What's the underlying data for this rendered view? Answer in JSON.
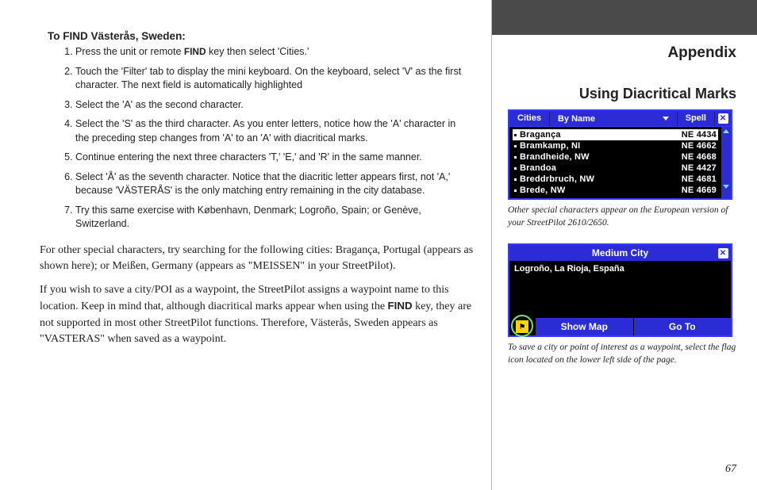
{
  "left": {
    "instr_title_prefix": "To FIND ",
    "instr_title_city": "Västerås, Sweden:",
    "steps": [
      "Press the unit or remote <b>FIND</b> key then select 'Cities.'",
      "Touch the 'Filter' tab to display the mini keyboard. On the keyboard, select 'V' as the first character. The next field is automatically highlighted",
      "Select the 'A' as the second character.",
      "Select the 'S' as the third character. As you enter letters, notice how the 'A' character in the preceding step changes from 'A' to an 'A' with diacritical marks.",
      "Continue entering the next three characters 'T,' 'E,' and 'R' in the same manner.",
      "Select 'Å' as the seventh character. Notice that the diacritic letter appears first, not 'A,' because 'VÄSTERÅS' is the only matching entry remaining in the city database.",
      "Try this same exercise with København, Denmark; Logroño, Spain; or Genève, Switzerland."
    ],
    "para1": "For other special characters, try searching for the following cities: Bragança, Portugal (appears as shown here); or Meißen, Germany (appears as \"MEISSEN\" in your StreetPilot).",
    "para2_a": "If you wish to save a city/POI as a waypoint, the StreetPilot assigns a waypoint name to this location. Keep in mind that, although diacritical marks appear when using the ",
    "para2_bold": "FIND",
    "para2_b": " key, they are not supported in most other StreetPilot functions. Therefore, Västerås, Sweden appears as \"VASTERAS\" when saved as a waypoint."
  },
  "right": {
    "appendix": "Appendix",
    "section": "Using Diacritical Marks",
    "device1": {
      "tab_cities": "Cities",
      "tab_sort": "By Name",
      "tab_spell": "Spell",
      "rows": [
        {
          "name": "Bragança",
          "dist": "NE 4434",
          "hl": true
        },
        {
          "name": "Bramkamp, NI",
          "dist": "NE 4662",
          "hl": false
        },
        {
          "name": "Brandheide, NW",
          "dist": "NE 4668",
          "hl": false
        },
        {
          "name": "Brandoa",
          "dist": "NE 4427",
          "hl": false
        },
        {
          "name": "Breddrbruch, NW",
          "dist": "NE 4681",
          "hl": false
        },
        {
          "name": "Brede, NW",
          "dist": "NE 4669",
          "hl": false
        }
      ]
    },
    "caption1": "Other special characters appear on the European version of your StreetPilot 2610/2650.",
    "device2": {
      "title": "Medium City",
      "line": "Logroño, La Rioja, España",
      "btn_map": "Show Map",
      "btn_goto": "Go To"
    },
    "caption2": "To save a city or point of interest as a waypoint, select the flag icon located on the lower left side of the page.",
    "page_num": "67"
  }
}
